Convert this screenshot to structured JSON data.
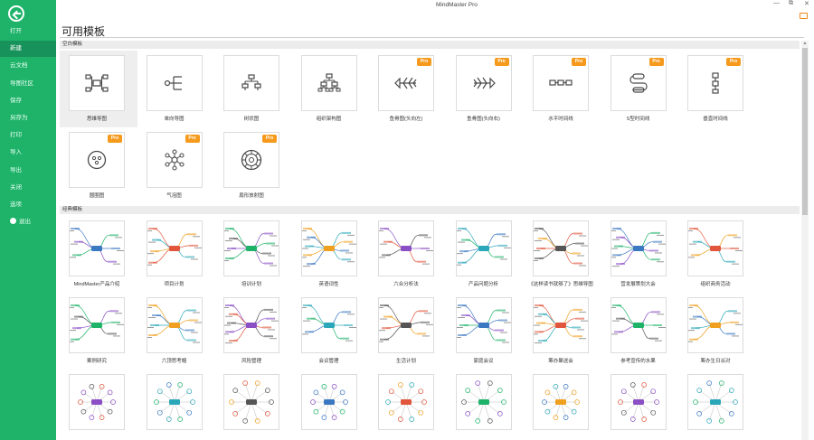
{
  "app_title": "MindMaster Pro",
  "window_controls": {
    "minimize": "—",
    "restore": "⧉",
    "close": "✕"
  },
  "sidebar": {
    "items": [
      {
        "label": "打开"
      },
      {
        "label": "新建"
      },
      {
        "label": "云文档"
      },
      {
        "label": "导图社区"
      },
      {
        "label": "保存"
      },
      {
        "label": "另存为"
      },
      {
        "label": "打印"
      },
      {
        "label": "导入"
      },
      {
        "label": "导出"
      },
      {
        "label": "关闭"
      },
      {
        "label": "选项"
      },
      {
        "label": "退出"
      }
    ]
  },
  "page_title": "可用模板",
  "sections": {
    "blank": {
      "title": "空白模板",
      "items": [
        {
          "label": "思维导图",
          "pro": false,
          "icon": "mindmap-icon"
        },
        {
          "label": "单向导图",
          "pro": false,
          "icon": "right-map-icon"
        },
        {
          "label": "树状图",
          "pro": false,
          "icon": "tree-icon"
        },
        {
          "label": "组织架构图",
          "pro": false,
          "icon": "org-chart-icon"
        },
        {
          "label": "鱼骨图(头向左)",
          "pro": true,
          "icon": "fishbone-left-icon"
        },
        {
          "label": "鱼骨图(头向右)",
          "pro": true,
          "icon": "fishbone-right-icon"
        },
        {
          "label": "水平时间线",
          "pro": true,
          "icon": "horizontal-timeline-icon"
        },
        {
          "label": "S型时间线",
          "pro": true,
          "icon": "s-timeline-icon"
        },
        {
          "label": "垂直时间线",
          "pro": true,
          "icon": "vertical-timeline-icon"
        },
        {
          "label": "圆圈图",
          "pro": true,
          "icon": "circle-map-icon"
        },
        {
          "label": "气泡图",
          "pro": true,
          "icon": "bubble-map-icon"
        },
        {
          "label": "扇形放射图",
          "pro": true,
          "icon": "sector-radial-icon"
        }
      ],
      "pro_label": "Pro"
    },
    "classic": {
      "title": "经典模板",
      "items": [
        {
          "label": "MindMaster产品介绍"
        },
        {
          "label": "项目计划"
        },
        {
          "label": "培训计划"
        },
        {
          "label": "英语词性"
        },
        {
          "label": "六合分析法"
        },
        {
          "label": "产品问题分析"
        },
        {
          "label": "《这样读书就够了》思维导图"
        },
        {
          "label": "营发展策划大会"
        },
        {
          "label": "组织商务活动"
        },
        {
          "label": "案例研究"
        },
        {
          "label": "六顶思考帽"
        },
        {
          "label": "风险管理"
        },
        {
          "label": "会议管理"
        },
        {
          "label": "生活计划"
        },
        {
          "label": "家庭会议"
        },
        {
          "label": "筹办聚送会"
        },
        {
          "label": "参考宣传的水果"
        },
        {
          "label": "筹办生日派对"
        },
        {
          "label": ""
        },
        {
          "label": ""
        },
        {
          "label": ""
        },
        {
          "label": ""
        },
        {
          "label": ""
        },
        {
          "label": ""
        },
        {
          "label": ""
        },
        {
          "label": ""
        },
        {
          "label": ""
        }
      ]
    }
  },
  "colors": {
    "sidebar": "#1fb36a",
    "sidebar_active": "#17925a",
    "pro_badge": "#f59a1c"
  }
}
